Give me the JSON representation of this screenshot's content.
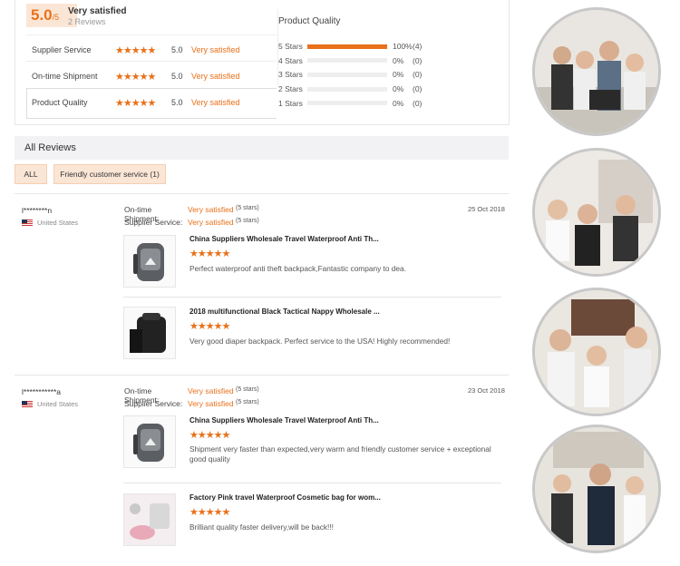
{
  "overall": {
    "score": "5.0",
    "out_of": "/5",
    "label": "Very satisfied",
    "count": "2 Reviews"
  },
  "categories": [
    {
      "name": "Supplier Service",
      "stars": "★★★★★",
      "score": "5.0",
      "desc": "Very satisfied"
    },
    {
      "name": "On-time Shipment",
      "stars": "★★★★★",
      "score": "5.0",
      "desc": "Very satisfied"
    },
    {
      "name": "Product Quality",
      "stars": "★★★★★",
      "score": "5.0",
      "desc": "Very satisfied"
    }
  ],
  "product_quality": {
    "title": "Product Quality",
    "bars": [
      {
        "label": "5 Stars",
        "fraction": 1.0,
        "pct": "100%",
        "count": "(4)"
      },
      {
        "label": "4 Stars",
        "fraction": 0,
        "pct": "0%",
        "count": "(0)"
      },
      {
        "label": "3 Stars",
        "fraction": 0,
        "pct": "0%",
        "count": "(0)"
      },
      {
        "label": "2 Stars",
        "fraction": 0,
        "pct": "0%",
        "count": "(0)"
      },
      {
        "label": "1 Stars",
        "fraction": 0,
        "pct": "0%",
        "count": "(0)"
      }
    ]
  },
  "all_reviews": {
    "title": "All Reviews"
  },
  "filters": [
    "ALL",
    "Friendly customer service (1)"
  ],
  "reviews": [
    {
      "reviewer": "l********n",
      "country": "United States",
      "date": "25 Oct 2018",
      "shipment_label": "On-time Shipment:",
      "shipment_value": "Very satisfied",
      "shipment_stars": "(5 stars)",
      "service_label": "Supplier Service:",
      "service_value": "Very satisfied",
      "service_stars": "(5 stars)",
      "items": [
        {
          "title": "China Suppliers Wholesale Travel Waterproof Anti Th...",
          "stars": "★★★★★",
          "comment": "Perfect waterproof anti theft backpack,Fantastic company to dea."
        },
        {
          "title": "2018 multifunctional Black Tactical Nappy Wholesale ...",
          "stars": "★★★★★",
          "comment": "Very good diaper backpack. Perfect service to the USA! Highly recommended!"
        }
      ]
    },
    {
      "reviewer": "l***********a",
      "country": "United States",
      "date": "23 Oct 2018",
      "shipment_label": "On-time Shipment:",
      "shipment_value": "Very satisfied",
      "shipment_stars": "(5 stars)",
      "service_label": "Supplier Service:",
      "service_value": "Very satisfied",
      "service_stars": "(5 stars)",
      "items": [
        {
          "title": "China Suppliers Wholesale Travel Waterproof Anti Th...",
          "stars": "★★★★★",
          "comment": "Shipment very faster than expected,very warm and friendly customer service + exceptional good quality"
        },
        {
          "title": "Factory Pink travel Waterproof Cosmetic bag for wom...",
          "stars": "★★★★★",
          "comment": "Brilliant quality faster delivery,will be back!!!"
        }
      ]
    }
  ],
  "colors": {
    "accent": "#e8711a",
    "accent_bg": "#fbe6d6",
    "bar_track": "#eeeeee"
  }
}
